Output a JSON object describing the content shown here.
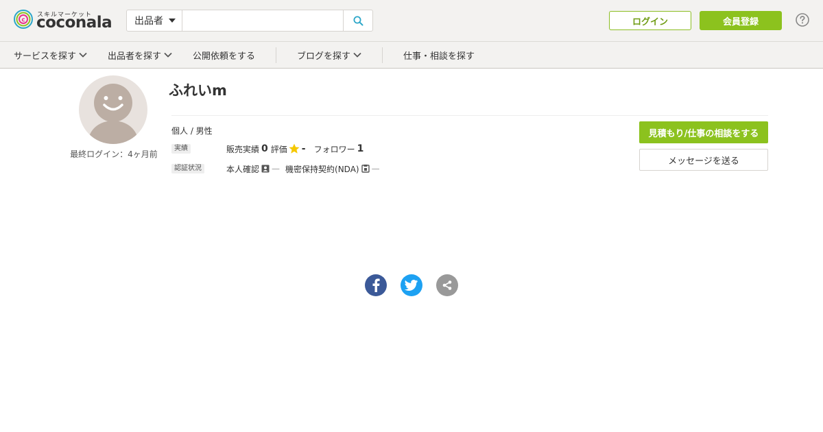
{
  "header": {
    "logo_sub": "スキルマーケット",
    "logo_word": "coconala",
    "search": {
      "category_selected": "出品者",
      "placeholder": ""
    },
    "login_label": "ログイン",
    "register_label": "会員登録",
    "help_icon": "question-circle-icon"
  },
  "nav": {
    "items": [
      {
        "label": "サービスを探す",
        "has_dropdown": true
      },
      {
        "label": "出品者を探す",
        "has_dropdown": true
      },
      {
        "label": "公開依頼をする",
        "has_dropdown": false
      },
      {
        "label": "ブログを探す",
        "has_dropdown": true
      },
      {
        "label": "仕事・相談を探す",
        "has_dropdown": false
      }
    ]
  },
  "profile": {
    "name": "ふれいm",
    "last_login": "最終ログイン：4ヶ月前",
    "type_line": "個人 / 男性",
    "record_tag": "実績",
    "sales_label": "販売実績",
    "sales_value": "0",
    "rating_label": "評価",
    "rating_value": "-",
    "follower_label": "フォロワー",
    "follower_value": "1",
    "verify_tag": "認証状況",
    "identity_label": "本人確認",
    "identity_status": "—",
    "nda_label": "機密保持契約(NDA)",
    "nda_status": "—"
  },
  "actions": {
    "quote_label": "見積もり/仕事の相談をする",
    "message_label": "メッセージを送る"
  },
  "share": [
    "facebook-icon",
    "twitter-icon",
    "share-icon"
  ],
  "colors": {
    "accent_green": "#8cc21e",
    "facebook": "#3b5998",
    "twitter": "#1da1f2",
    "share_gray": "#999999",
    "star": "#f5c800"
  }
}
